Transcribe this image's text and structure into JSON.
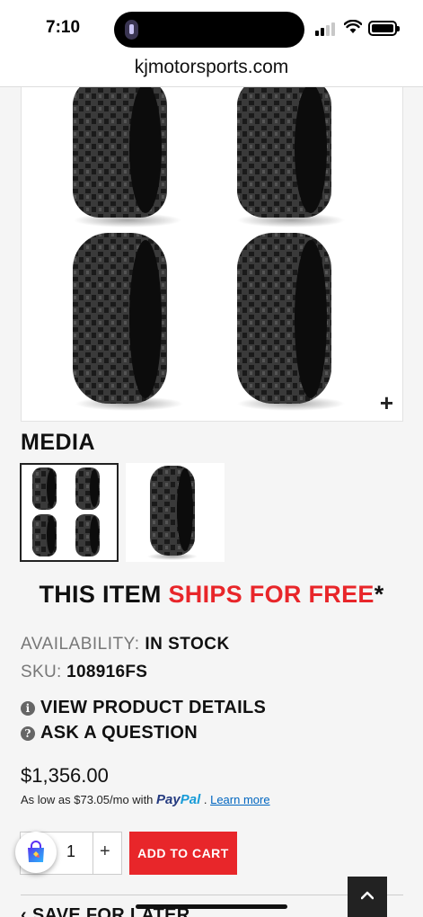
{
  "status_bar": {
    "time": "7:10"
  },
  "browser": {
    "url": "kjmotorsports.com"
  },
  "gallery": {
    "media_title": "MEDIA",
    "zoom_label": "+"
  },
  "shipping": {
    "prefix": "THIS ITEM ",
    "highlight": "SHIPS FOR FREE",
    "suffix": "*"
  },
  "product": {
    "availability_label": "AVAILABILITY:",
    "availability_value": "IN STOCK",
    "sku_label": "SKU:",
    "sku_value": "108916FS",
    "view_details": "VIEW PRODUCT DETAILS",
    "ask_question": "ASK A QUESTION",
    "price": "$1,356.00"
  },
  "financing": {
    "text": "As low as $73.05/mo with",
    "brand_part1": "Pay",
    "brand_part2": "Pal",
    "sep": " . ",
    "learn_more": "Learn more"
  },
  "cart": {
    "quantity": "1",
    "plus": "+",
    "add_to_cart": "ADD TO CART",
    "save_for_later": "‹ SAVE FOR LATER"
  },
  "colors": {
    "accent_red": "#e8262a",
    "paypal_dark": "#253b80",
    "paypal_light": "#179bd7"
  },
  "icons": [
    "info-icon",
    "question-icon",
    "shopping-bag-icon",
    "chevron-up-icon",
    "wifi-icon",
    "battery-icon",
    "signal-icon"
  ]
}
